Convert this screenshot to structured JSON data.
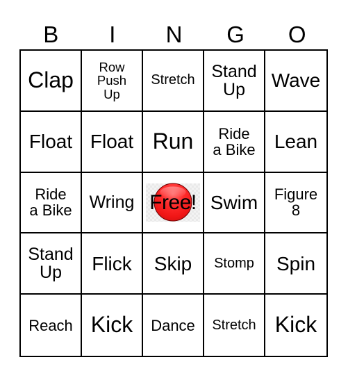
{
  "card": {
    "header_letters": [
      "B",
      "I",
      "N",
      "G",
      "O"
    ],
    "free_space": {
      "label": "Free!",
      "marker_color": "#ff2020",
      "marker_icon": "red-circle-marker"
    },
    "rows": [
      [
        {
          "text": "Clap",
          "size": "xl"
        },
        {
          "text": "Row\nPush\nUp",
          "size": "xxs"
        },
        {
          "text": "Stretch",
          "size": "xs"
        },
        {
          "text": "Stand\nUp",
          "size": "m"
        },
        {
          "text": "Wave",
          "size": "l"
        }
      ],
      [
        {
          "text": "Float",
          "size": "l"
        },
        {
          "text": "Float",
          "size": "l"
        },
        {
          "text": "Run",
          "size": "xl"
        },
        {
          "text": "Ride\na Bike",
          "size": "s"
        },
        {
          "text": "Lean",
          "size": "l"
        }
      ],
      [
        {
          "text": "Ride\na Bike",
          "size": "s"
        },
        {
          "text": "Wring",
          "size": "m"
        },
        {
          "text": "Free!",
          "size": "free",
          "free": true
        },
        {
          "text": "Swim",
          "size": "l"
        },
        {
          "text": "Figure\n8",
          "size": "s"
        }
      ],
      [
        {
          "text": "Stand\nUp",
          "size": "m"
        },
        {
          "text": "Flick",
          "size": "l"
        },
        {
          "text": "Skip",
          "size": "l"
        },
        {
          "text": "Stomp",
          "size": "xs"
        },
        {
          "text": "Spin",
          "size": "l"
        }
      ],
      [
        {
          "text": "Reach",
          "size": "s"
        },
        {
          "text": "Kick",
          "size": "xl"
        },
        {
          "text": "Dance",
          "size": "s"
        },
        {
          "text": "Stretch",
          "size": "xs"
        },
        {
          "text": "Kick",
          "size": "xl"
        }
      ]
    ]
  }
}
